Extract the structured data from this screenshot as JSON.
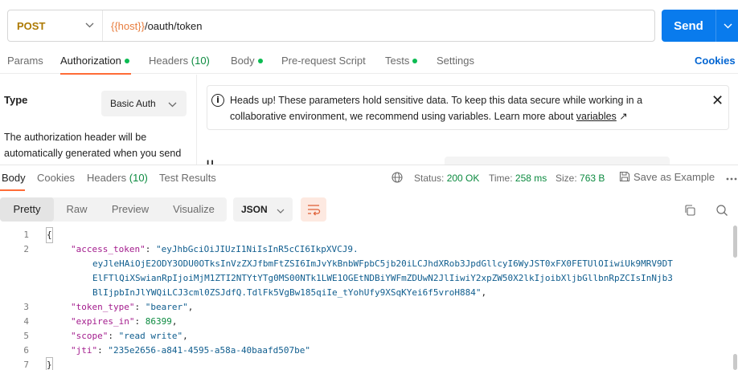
{
  "request": {
    "method": "POST",
    "url_var": "{{host}}",
    "url_path": "/oauth/token",
    "send_label": "Send"
  },
  "tabs": {
    "params": "Params",
    "authorization": "Authorization",
    "headers": "Headers",
    "headers_count": "(10)",
    "body": "Body",
    "prerequest": "Pre-request Script",
    "tests": "Tests",
    "settings": "Settings",
    "cookies": "Cookies"
  },
  "auth": {
    "type_label": "Type",
    "type_value": "Basic Auth",
    "description": "The authorization header will be automatically generated when you send",
    "notice_line1": "Heads up! These parameters hold sensitive data. To keep this data secure while working in a",
    "notice_line2_pre": "collaborative environment, we recommend using variables. Learn more about ",
    "notice_link": "variables",
    "notice_arrow": "↗",
    "ghost_heading": "U"
  },
  "response": {
    "tabs": {
      "body": "Body",
      "cookies": "Cookies",
      "headers": "Headers",
      "headers_count": "(10)",
      "test_results": "Test Results"
    },
    "status_label": "Status:",
    "status_value": "200 OK",
    "time_label": "Time:",
    "time_value": "258 ms",
    "size_label": "Size:",
    "size_value": "763 B",
    "save_example": "Save as Example",
    "more": "ooo",
    "views": [
      "Pretty",
      "Raw",
      "Preview",
      "Visualize"
    ],
    "format": "JSON"
  },
  "code": {
    "line_numbers": [
      "1",
      "2",
      "3",
      "4",
      "5",
      "6",
      "7"
    ],
    "open_brace": "{",
    "close_brace": "}",
    "access_token_key": "\"access_token\"",
    "access_token_val1": "\"eyJhbGciOiJIUzI1NiIsInR5cCI6IkpXVCJ9.",
    "access_token_val2": "eyJleHAiOjE2ODY3ODU0OTksInVzZXJfbmFtZSI6ImJvYkBnbWFpbC5jb20iLCJhdXRob3JpdGllcyI6WyJST0xFX0FETUlOIiwiUk9MRV9DT",
    "access_token_val3": "ElFTlQiXSwianRpIjoiMjM1ZTI2NTYtYTg0MS00NTk1LWE1OGEtNDBiYWFmZDUwN2JlIiwiY2xpZW50X2lkIjoibXljbGllbnRpZCIsInNjb3",
    "access_token_val4": "BlIjpbInJlYWQiLCJ3cml0ZSJdfQ.TdlFk5VgBw185qiIe_tYohUfy9XSqKYei6f5vroH884\"",
    "token_type_key": "\"token_type\"",
    "token_type_val": "\"bearer\"",
    "expires_in_key": "\"expires_in\"",
    "expires_in_val": "86399",
    "scope_key": "\"scope\"",
    "scope_val": "\"read write\"",
    "jti_key": "\"jti\"",
    "jti_val": "\"235e2656-a841-4595-a58a-40baafd507be\""
  }
}
